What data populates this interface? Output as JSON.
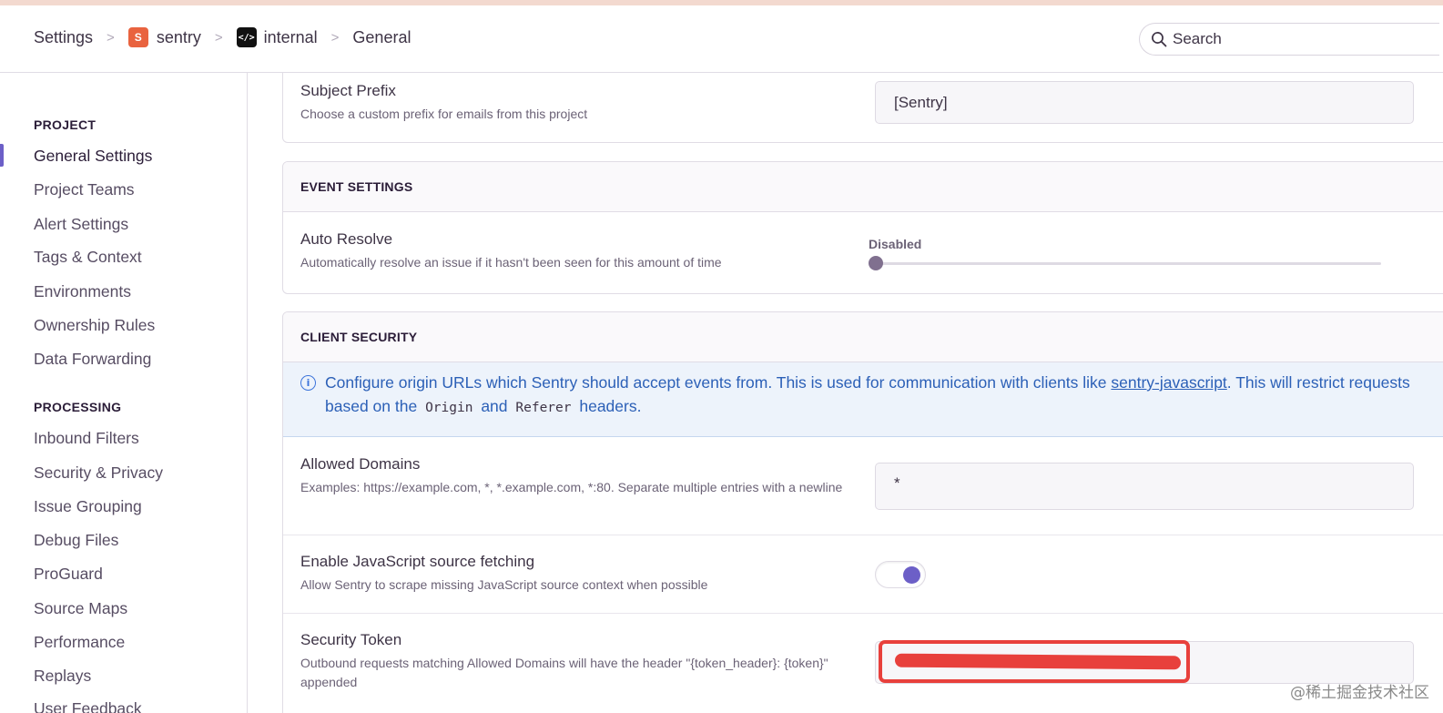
{
  "breadcrumb": {
    "settings": "Settings",
    "project_badge": "S",
    "project": "sentry",
    "org_badge": "</>",
    "org": "internal",
    "current": "General",
    "separator": ">"
  },
  "search": {
    "placeholder": "Search"
  },
  "sidebar": {
    "project_heading": "PROJECT",
    "project_items": [
      {
        "label": "General Settings",
        "active": true
      },
      {
        "label": "Project Teams"
      },
      {
        "label": "Alert Settings"
      },
      {
        "label": "Tags & Context"
      },
      {
        "label": "Environments"
      },
      {
        "label": "Ownership Rules"
      },
      {
        "label": "Data Forwarding"
      }
    ],
    "processing_heading": "PROCESSING",
    "processing_items": [
      {
        "label": "Inbound Filters"
      },
      {
        "label": "Security & Privacy"
      },
      {
        "label": "Issue Grouping"
      },
      {
        "label": "Debug Files"
      },
      {
        "label": "ProGuard"
      },
      {
        "label": "Source Maps"
      },
      {
        "label": "Performance"
      },
      {
        "label": "Replays"
      },
      {
        "label": "User Feedback"
      }
    ]
  },
  "email_panel": {
    "subject_prefix": {
      "label": "Subject Prefix",
      "help": "Choose a custom prefix for emails from this project",
      "value": "[Sentry]"
    }
  },
  "event_settings": {
    "title": "EVENT SETTINGS",
    "auto_resolve": {
      "label": "Auto Resolve",
      "help": "Automatically resolve an issue if it hasn't been seen for this amount of time",
      "value_label": "Disabled",
      "slider_value": 0
    }
  },
  "client_security": {
    "title": "CLIENT SECURITY",
    "alert": {
      "text_1": "Configure origin URLs which Sentry should accept events from. This is used for communication with clients like ",
      "link": "sentry-javascript",
      "text_2": ". This will restrict requests based on the ",
      "code_1": "Origin",
      "text_3": " and ",
      "code_2": "Referer",
      "text_4": " headers."
    },
    "allowed_domains": {
      "label": "Allowed Domains",
      "help": "Examples: https://example.com, *, *.example.com, *:80. Separate multiple entries with a newline",
      "value": "*"
    },
    "js_source_fetching": {
      "label": "Enable JavaScript source fetching",
      "help": "Allow Sentry to scrape missing JavaScript source context when possible",
      "enabled": true
    },
    "security_token": {
      "label": "Security Token",
      "help": "Outbound requests matching Allowed Domains will have the header \"{token_header}: {token}\" appended"
    }
  },
  "colors": {
    "accent": "#6c5fc7",
    "alert_text": "#2c60b7",
    "alert_bg": "#edf3fb",
    "redaction": "#e8403c",
    "project_badge": "#e9633f"
  },
  "watermark": "@稀土掘金技术社区"
}
